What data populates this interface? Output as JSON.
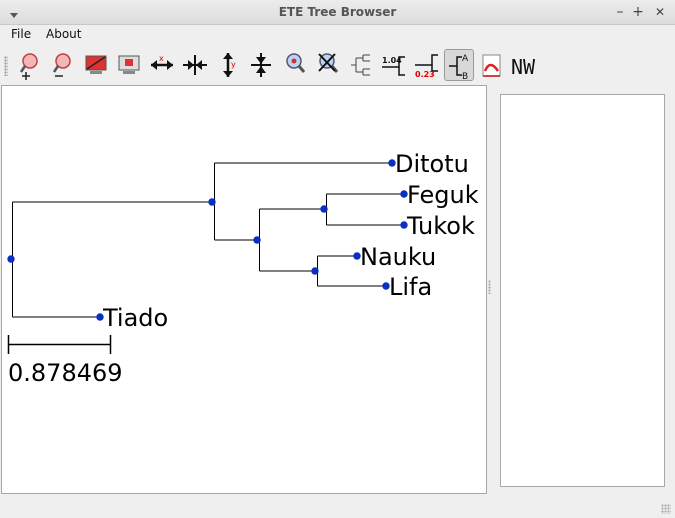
{
  "window": {
    "title": "ETE Tree Browser",
    "minimize_glyph": "–",
    "maximize_glyph": "+",
    "close_glyph": "✕"
  },
  "menubar": {
    "items": [
      "File",
      "About"
    ]
  },
  "toolbar": {
    "buttons": [
      {
        "icon": "zoom-in-icon"
      },
      {
        "icon": "zoom-out-icon"
      },
      {
        "icon": "fit-to-window-icon"
      },
      {
        "icon": "fit-selection-icon"
      },
      {
        "icon": "expand-horizontal-icon"
      },
      {
        "icon": "shrink-horizontal-icon"
      },
      {
        "icon": "expand-vertical-icon"
      },
      {
        "icon": "shrink-vertical-icon"
      },
      {
        "icon": "search-node-icon"
      },
      {
        "icon": "clear-search-icon"
      },
      {
        "icon": "force-topology-icon"
      },
      {
        "icon": "show-branch-length-icon",
        "text": "1.04"
      },
      {
        "icon": "show-branch-support-icon",
        "text": "0.23"
      },
      {
        "icon": "show-leaf-names-icon",
        "text_top": "A",
        "text_bottom": "B",
        "active": true
      },
      {
        "icon": "render-image-icon"
      },
      {
        "icon": "newick-export-icon",
        "text": "NW"
      }
    ]
  },
  "tree": {
    "leaves": [
      "Ditotu",
      "Feguk",
      "Tukok",
      "Nauku",
      "Lifa",
      "Tiado"
    ],
    "scale_label": "0.878469",
    "node_color": "#0a2fc4",
    "line_color": "#000000"
  }
}
